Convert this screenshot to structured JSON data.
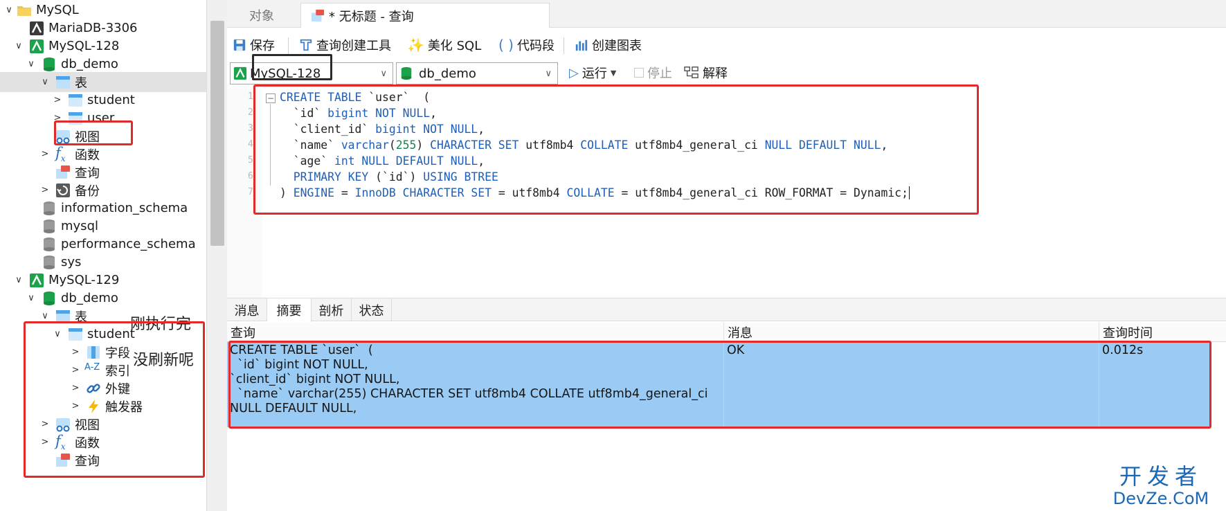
{
  "tree": {
    "items": [
      {
        "label": "MySQL",
        "icon": "folder-icon"
      },
      {
        "label": "MariaDB-3306",
        "icon": "mariadb-connection-icon"
      },
      {
        "label": "MySQL-128",
        "icon": "mysql-connection-icon"
      },
      {
        "label": "db_demo",
        "icon": "database-icon"
      },
      {
        "label": "表",
        "icon": "table-folder-icon"
      },
      {
        "label": "student",
        "icon": "table-icon"
      },
      {
        "label": "user",
        "icon": "table-icon"
      },
      {
        "label": "视图",
        "icon": "view-icon"
      },
      {
        "label": "函数",
        "icon": "function-icon"
      },
      {
        "label": "查询",
        "icon": "query-icon"
      },
      {
        "label": "备份",
        "icon": "backup-icon"
      },
      {
        "label": "information_schema",
        "icon": "database-icon"
      },
      {
        "label": "mysql",
        "icon": "database-icon"
      },
      {
        "label": "performance_schema",
        "icon": "database-icon"
      },
      {
        "label": "sys",
        "icon": "database-icon"
      },
      {
        "label": "MySQL-129",
        "icon": "mysql-connection-icon"
      },
      {
        "label": "db_demo",
        "icon": "database-icon"
      },
      {
        "label": "表",
        "icon": "table-folder-icon"
      },
      {
        "label": "student",
        "icon": "table-icon"
      },
      {
        "label": "字段",
        "icon": "fields-icon"
      },
      {
        "label": "索引",
        "icon": "index-icon"
      },
      {
        "label": "外键",
        "icon": "foreign-key-icon"
      },
      {
        "label": "触发器",
        "icon": "trigger-icon"
      },
      {
        "label": "视图",
        "icon": "view-icon"
      },
      {
        "label": "函数",
        "icon": "function-icon"
      },
      {
        "label": "查询",
        "icon": "query-icon"
      }
    ]
  },
  "annotations": {
    "just_executed": "刚执行完",
    "not_refreshed": "没刷新呢"
  },
  "tabs": {
    "objects": "对象",
    "query": "* 无标题 - 查询"
  },
  "toolbar": {
    "save": "保存",
    "query_builder": "查询创建工具",
    "beautify_sql": "美化 SQL",
    "code_snippet": "代码段",
    "create_chart": "创建图表"
  },
  "query_toolbar": {
    "connection": "MySQL-128",
    "database": "db_demo",
    "run": "运行",
    "stop": "停止",
    "explain": "解释"
  },
  "editor": {
    "line_numbers": [
      "1",
      "2",
      "3",
      "4",
      "5",
      "6",
      "7"
    ]
  },
  "result_tabs": [
    "消息",
    "摘要",
    "剖析",
    "状态"
  ],
  "result_grid": {
    "columns": [
      "查询",
      "消息",
      "查询时间"
    ],
    "rows": [
      {
        "query": "CREATE TABLE `user`  (\n  `id` bigint NOT NULL,\n`client_id` bigint NOT NULL,\n  `name` varchar(255) CHARACTER SET utf8mb4 COLLATE utf8mb4_general_ci\nNULL DEFAULT NULL,",
        "message": "OK",
        "time": "0.012s"
      }
    ]
  },
  "watermark": {
    "line1": "开发者",
    "line2": "DevZe.CoM"
  },
  "colors": {
    "selection_blue": "#99cbf5",
    "keyword_blue": "#1f5fb8",
    "highlight_red": "#e22a2a",
    "mysql_green": "#1aa34a"
  }
}
